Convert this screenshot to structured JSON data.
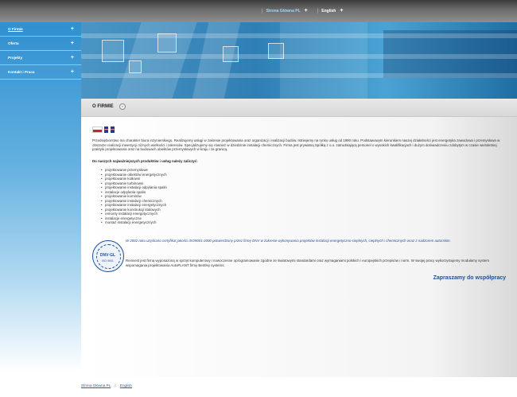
{
  "top_nav": {
    "home": "Strona Główna PL",
    "english": "English"
  },
  "sidebar": {
    "items": [
      {
        "label": "O Firmie"
      },
      {
        "label": "Oferta"
      },
      {
        "label": "Projekty"
      },
      {
        "label": "Kontakt i Praca"
      }
    ]
  },
  "section": {
    "title": "O FIRMIE"
  },
  "intro": "Przedsiębiorstwo ma charakter biura inżynierskiego. Realizujemy usługi w zakresie projektowania oraz organizacji i realizacji budów. Istniejemy na rynku usług od 1990 roku. Podstawowym kierunkiem naszej działalności jest energetyka zawodowa i przemysłowa w obszarze realizacji inwestycji różnych wielkości i zakresów. Specjalizujemy się również w dziedzinie instalacji chemicznych. Firma jest prywatną Spółką z o.o. zatrudniającą personel o wysokich kwalifikacjach i dużym doświadczeniu zdobytym w czasie wieloletniej praktyki projektowania oraz na budowach obiektów przemysłowych w kraju i za granicą.",
  "scope_heading": "Do naszych najważniejszych produktów i usług należy zaliczyć:",
  "services": [
    "projektowanie przemysłowe",
    "projektowanie obiektów energetycznych",
    "projektowanie kotłowni",
    "projektowanie turbinowni",
    "projektowanie instalacji odpylania spalin",
    "instalacje odpylania spalin",
    "projektowanie kominów",
    "projektowanie instalacji chemicznych",
    "projektowanie instalacji energetycznych",
    "projektowanie konstrukcji stalowych",
    "remonty instalacji energetycznych",
    "instalacje energetyczne",
    "montaż instalacji energetycznych"
  ],
  "cert_badge": {
    "name": "DNV·GL",
    "sub": "ISO 9001"
  },
  "cert_text": "W 2002 roku uzyskano certyfikat jakości ISO9001-2000 potwierdzony przez firmę DNV w zakresie wykonywania projektów instalacji energetyczno-cieplnych, cieplnych i chemicznych wraz z nadzorem autorskim.",
  "tools_text": "Reinvest jest firmą wyposażoną w sprzęt komputerowy i nowoczesne oprogramowanie zgodne ze światowymi standardami oraz wymaganiami polskich i europejskich przepisów i norm. W swojej pracy wykorzystujemy modułamy system wspomagania projektowania AutoPLANT firmy Bentley systems.",
  "closing": "Zapraszamy do współpracy",
  "footer": {
    "home": "Strona Główna PL",
    "english": "English",
    "separator": "|"
  },
  "icons": {
    "menu_plus": "+",
    "section_arrow": "»"
  }
}
